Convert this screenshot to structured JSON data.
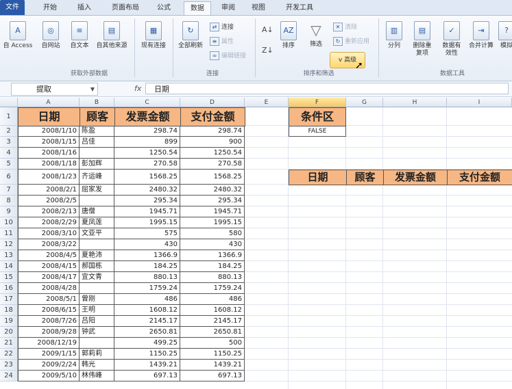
{
  "tabs": [
    "文件",
    "开始",
    "插入",
    "页面布局",
    "公式",
    "数据",
    "审阅",
    "视图",
    "开发工具"
  ],
  "active_tab": "数据",
  "ribbon": {
    "get_external": {
      "buttons": [
        "自 Access",
        "自网站",
        "自文本",
        "自其他来源",
        "现有连接"
      ],
      "group_label": "获取外部数据"
    },
    "connections": {
      "button": "全部刷新",
      "small": [
        "连接",
        "属性",
        "编辑链接"
      ],
      "group_label": "连接"
    },
    "sort_filter": {
      "sort": "排序",
      "filter": "筛选",
      "small": [
        "清除",
        "重新应用"
      ],
      "advanced": "高级",
      "group_label": "排序和筛选"
    },
    "data_tools": {
      "buttons": [
        "分列",
        "删除重复项",
        "数据有效性",
        "合并计算",
        "模拟"
      ],
      "group_label": "数据工具"
    }
  },
  "formula_bar": {
    "name_box": "提取",
    "fx": "fx",
    "value": "日期"
  },
  "columns": [
    "A",
    "B",
    "C",
    "D",
    "E",
    "F",
    "G",
    "H",
    "I"
  ],
  "headers": [
    "日期",
    "顾客",
    "发票金额",
    "支付金额"
  ],
  "rows": [
    [
      "2008/1/10",
      "陈盈",
      "298.74",
      "298.74"
    ],
    [
      "2008/1/15",
      "吕佳",
      "899",
      "900"
    ],
    [
      "2008/1/16",
      "",
      "1250.54",
      "1250.54"
    ],
    [
      "2008/1/18",
      "彭加辉",
      "270.58",
      "270.58"
    ],
    [
      "2008/1/23",
      "齐运峰",
      "1568.25",
      "1568.25"
    ],
    [
      "2008/2/1",
      "屈家发",
      "2480.32",
      "2480.32"
    ],
    [
      "2008/2/5",
      "",
      "295.34",
      "295.34"
    ],
    [
      "2008/2/13",
      "唐僧",
      "1945.71",
      "1945.71"
    ],
    [
      "2008/2/29",
      "夏凤莲",
      "1995.15",
      "1995.15"
    ],
    [
      "2008/3/10",
      "文亚平",
      "575",
      "580"
    ],
    [
      "2008/3/22",
      "",
      "430",
      "430"
    ],
    [
      "2008/4/5",
      "夏艳沛",
      "1366.9",
      "1366.9"
    ],
    [
      "2008/4/15",
      "郝国栋",
      "184.25",
      "184.25"
    ],
    [
      "2008/4/17",
      "宜文青",
      "880.13",
      "880.13"
    ],
    [
      "2008/4/28",
      "",
      "1759.24",
      "1759.24"
    ],
    [
      "2008/5/1",
      "曾刚",
      "486",
      "486"
    ],
    [
      "2008/6/15",
      "王明",
      "1608.12",
      "1608.12"
    ],
    [
      "2008/7/26",
      "吕阳",
      "2145.17",
      "2145.17"
    ],
    [
      "2008/9/28",
      "钟武",
      "2650.81",
      "2650.81"
    ],
    [
      "2008/12/19",
      "",
      "499.25",
      "500"
    ],
    [
      "2009/1/15",
      "郭莉莉",
      "1150.25",
      "1150.25"
    ],
    [
      "2009/2/24",
      "韩光",
      "1439.21",
      "1439.21"
    ],
    [
      "2009/5/10",
      "林伟峰",
      "697.13",
      "697.13"
    ]
  ],
  "criteria": {
    "header": "条件区",
    "value": "FALSE"
  },
  "output_headers": [
    "日期",
    "顾客",
    "发票金额",
    "支付金额"
  ]
}
